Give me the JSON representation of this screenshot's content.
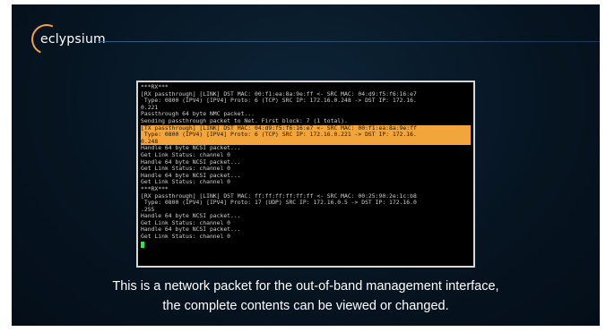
{
  "brand": {
    "logo_text": "eclypsium"
  },
  "terminal": {
    "lines": [
      {
        "text": "***RX***",
        "highlight": false
      },
      {
        "text": "[RX passthrough] [LINK] DST MAC: 00:f1:ea:8a:9e:ff <- SRC MAC: 04:d9:f5:f6:16:e7",
        "highlight": false
      },
      {
        "text": " Type: 0800 (IPV4) [IPV4] Proto: 6 (TCP) SRC IP: 172.16.0.248 -> DST IP: 172.16.",
        "highlight": false
      },
      {
        "text": "0.221",
        "highlight": false
      },
      {
        "text": "Passthrough 64 byte NMC packet...",
        "highlight": false
      },
      {
        "text": "Sending passthrough packet to Net. First block: 7 (1 total).",
        "highlight": false
      },
      {
        "text": "[TX passthrough] [LINK] DST MAC: 04:d9:f5:f6:16:e7 <- SRC MAC: 00:f1:ea:8a:9e:ff",
        "highlight": true
      },
      {
        "text": " Type: 0800 (IPV4) [IPV4] Proto: 6 (TCP) SRC IP: 172.16.0.221 -> DST IP: 172.16.",
        "highlight": true
      },
      {
        "text": "0.248",
        "highlight": true
      },
      {
        "text": "Handle 64 byte NCSI packet...",
        "highlight": false
      },
      {
        "text": "Get Link Status: channel 0",
        "highlight": false
      },
      {
        "text": "Handle 64 byte NCSI packet...",
        "highlight": false
      },
      {
        "text": "Get Link Status: channel 0",
        "highlight": false
      },
      {
        "text": "Handle 64 byte NCSI packet...",
        "highlight": false
      },
      {
        "text": "Get Link Status: channel 0",
        "highlight": false
      },
      {
        "text": "***RX***",
        "highlight": false
      },
      {
        "text": "[RX passthrough] [LINK] DST MAC: ff:ff:ff:ff:ff:ff <- SRC MAC: 00:25:90:2e:1c:b8",
        "highlight": false
      },
      {
        "text": " Type: 0800 (IPV4) [IPV4] Proto: 17 (UDP) SRC IP: 172.16.0.5 -> DST IP: 172.16.0",
        "highlight": false
      },
      {
        "text": ".255",
        "highlight": false
      },
      {
        "text": "Handle 64 byte NCSI packet...",
        "highlight": false
      },
      {
        "text": "Get Link Status: channel 0",
        "highlight": false
      },
      {
        "text": "Handle 64 byte NCSI packet...",
        "highlight": false
      },
      {
        "text": "Get Link Status: channel 0",
        "highlight": false
      }
    ],
    "cursor_color": "#2fe84a",
    "highlight_color": "#f2a53a"
  },
  "caption": {
    "line1": "This is a network packet for the out-of-band management interface,",
    "line2": "the complete contents can be viewed or changed."
  }
}
